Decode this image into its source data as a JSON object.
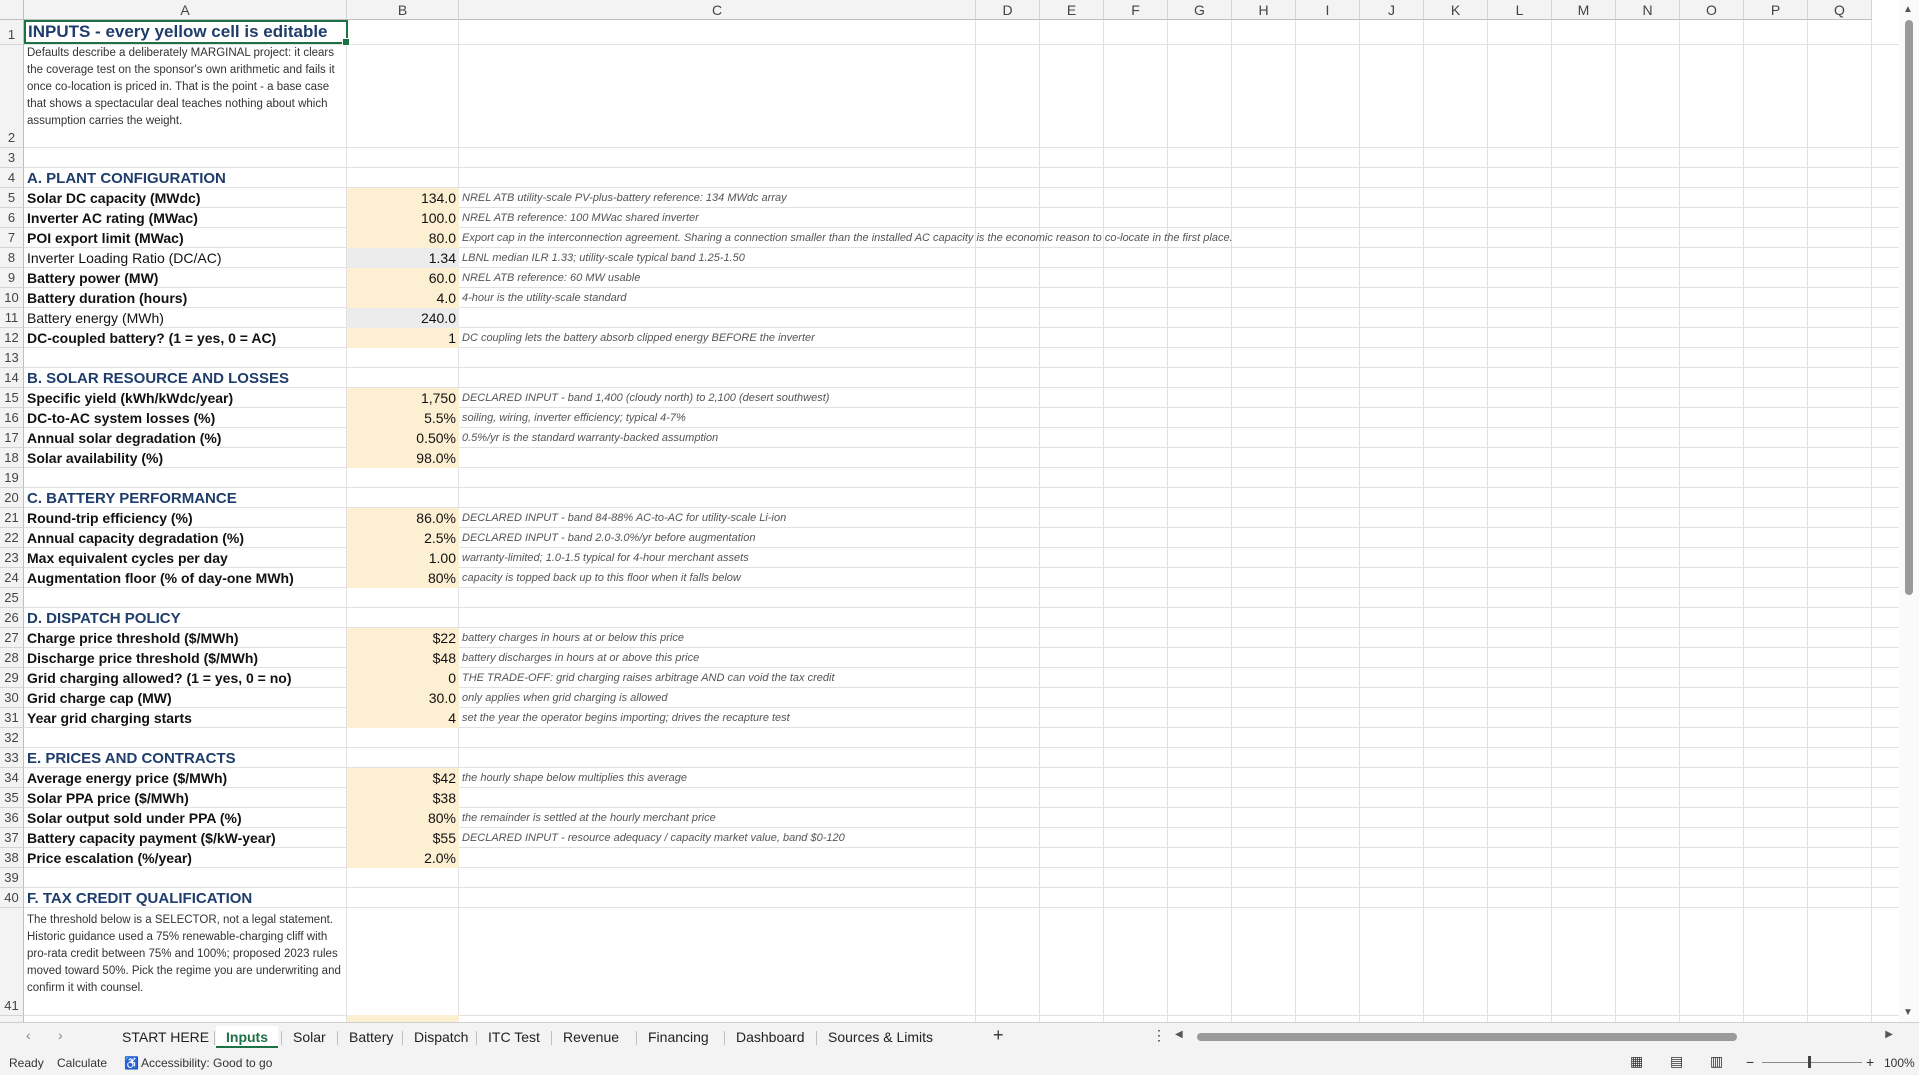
{
  "columns": [
    "A",
    "B",
    "C",
    "D",
    "E",
    "F",
    "G",
    "H",
    "I",
    "J",
    "K",
    "L",
    "M",
    "N",
    "O",
    "P",
    "Q"
  ],
  "title": "INPUTS - every yellow cell is editable",
  "intro_note": "Defaults describe a deliberately MARGINAL project: it clears the coverage test on the sponsor's own arithmetic and fails it once co-location is priced in. That is the point - a base case that shows a spectacular deal teaches nothing about which assumption carries the weight.",
  "rows": [
    {
      "num": "3",
      "a": "",
      "b": "",
      "c": ""
    },
    {
      "num": "4",
      "a": "A. PLANT CONFIGURATION",
      "b": "",
      "c": "",
      "kind": "section"
    },
    {
      "num": "5",
      "a": "Solar DC capacity (MWdc)",
      "b": "134.0",
      "c": "NREL ATB utility-scale PV-plus-battery reference: 134 MWdc array",
      "kind": "input"
    },
    {
      "num": "6",
      "a": "Inverter AC rating (MWac)",
      "b": "100.0",
      "c": "NREL ATB reference: 100 MWac shared inverter",
      "kind": "input"
    },
    {
      "num": "7",
      "a": "POI export limit (MWac)",
      "b": "80.0",
      "c": "Export cap in the interconnection agreement. Sharing a connection smaller than the installed AC capacity is the economic reason to co-locate in the first place.",
      "kind": "input"
    },
    {
      "num": "8",
      "a": "Inverter Loading Ratio (DC/AC)",
      "b": "1.34",
      "c": "LBNL median ILR 1.33; utility-scale typical band 1.25-1.50",
      "kind": "calc"
    },
    {
      "num": "9",
      "a": "Battery power (MW)",
      "b": "60.0",
      "c": "NREL ATB reference: 60 MW usable",
      "kind": "input"
    },
    {
      "num": "10",
      "a": "Battery duration (hours)",
      "b": "4.0",
      "c": "4-hour is the utility-scale standard",
      "kind": "input"
    },
    {
      "num": "11",
      "a": "Battery energy (MWh)",
      "b": "240.0",
      "c": "",
      "kind": "calc"
    },
    {
      "num": "12",
      "a": "DC-coupled battery? (1 = yes, 0 = AC)",
      "b": "1",
      "c": "DC coupling lets the battery absorb clipped energy BEFORE the inverter",
      "kind": "input"
    },
    {
      "num": "13",
      "a": "",
      "b": "",
      "c": ""
    },
    {
      "num": "14",
      "a": "B. SOLAR RESOURCE AND LOSSES",
      "b": "",
      "c": "",
      "kind": "section"
    },
    {
      "num": "15",
      "a": "Specific yield (kWh/kWdc/year)",
      "b": "1,750",
      "c": "DECLARED INPUT - band 1,400 (cloudy north) to 2,100 (desert southwest)",
      "kind": "input"
    },
    {
      "num": "16",
      "a": "DC-to-AC system losses (%)",
      "b": "5.5%",
      "c": "soiling, wiring, inverter efficiency; typical 4-7%",
      "kind": "input"
    },
    {
      "num": "17",
      "a": "Annual solar degradation (%)",
      "b": "0.50%",
      "c": "0.5%/yr is the standard warranty-backed assumption",
      "kind": "input"
    },
    {
      "num": "18",
      "a": "Solar availability (%)",
      "b": "98.0%",
      "c": "",
      "kind": "input"
    },
    {
      "num": "19",
      "a": "",
      "b": "",
      "c": ""
    },
    {
      "num": "20",
      "a": "C. BATTERY PERFORMANCE",
      "b": "",
      "c": "",
      "kind": "section"
    },
    {
      "num": "21",
      "a": "Round-trip efficiency (%)",
      "b": "86.0%",
      "c": "DECLARED INPUT - band 84-88% AC-to-AC for utility-scale Li-ion",
      "kind": "input"
    },
    {
      "num": "22",
      "a": "Annual capacity degradation (%)",
      "b": "2.5%",
      "c": "DECLARED INPUT - band 2.0-3.0%/yr before augmentation",
      "kind": "input"
    },
    {
      "num": "23",
      "a": "Max equivalent cycles per day",
      "b": "1.00",
      "c": "warranty-limited; 1.0-1.5 typical for 4-hour merchant assets",
      "kind": "input"
    },
    {
      "num": "24",
      "a": "Augmentation floor (% of day-one MWh)",
      "b": "80%",
      "c": "capacity is topped back up to this floor when it falls below",
      "kind": "input"
    },
    {
      "num": "25",
      "a": "",
      "b": "",
      "c": ""
    },
    {
      "num": "26",
      "a": "D. DISPATCH POLICY",
      "b": "",
      "c": "",
      "kind": "section"
    },
    {
      "num": "27",
      "a": "Charge price threshold ($/MWh)",
      "b": "$22",
      "c": "battery charges in hours at or below this price",
      "kind": "input"
    },
    {
      "num": "28",
      "a": "Discharge price threshold ($/MWh)",
      "b": "$48",
      "c": "battery discharges in hours at or above this price",
      "kind": "input"
    },
    {
      "num": "29",
      "a": "Grid charging allowed? (1 = yes, 0 = no)",
      "b": "0",
      "c": "THE TRADE-OFF: grid charging raises arbitrage AND can void the tax credit",
      "kind": "input"
    },
    {
      "num": "30",
      "a": "Grid charge cap (MW)",
      "b": "30.0",
      "c": "only applies when grid charging is allowed",
      "kind": "input"
    },
    {
      "num": "31",
      "a": "Year grid charging starts",
      "b": "4",
      "c": "set the year the operator begins importing; drives the recapture test",
      "kind": "input"
    },
    {
      "num": "32",
      "a": "",
      "b": "",
      "c": ""
    },
    {
      "num": "33",
      "a": "E. PRICES AND CONTRACTS",
      "b": "",
      "c": "",
      "kind": "section"
    },
    {
      "num": "34",
      "a": "Average energy price ($/MWh)",
      "b": "$42",
      "c": "the hourly shape below multiplies this average",
      "kind": "input"
    },
    {
      "num": "35",
      "a": "Solar PPA price ($/MWh)",
      "b": "$38",
      "c": "",
      "kind": "input"
    },
    {
      "num": "36",
      "a": "Solar output sold under PPA (%)",
      "b": "80%",
      "c": "the remainder is settled at the hourly merchant price",
      "kind": "input"
    },
    {
      "num": "37",
      "a": "Battery capacity payment ($/kW-year)",
      "b": "$55",
      "c": "DECLARED INPUT - resource adequacy / capacity market value, band $0-120",
      "kind": "input"
    },
    {
      "num": "38",
      "a": "Price escalation (%/year)",
      "b": "2.0%",
      "c": "",
      "kind": "input"
    },
    {
      "num": "39",
      "a": "",
      "b": "",
      "c": ""
    },
    {
      "num": "40",
      "a": "F. TAX CREDIT QUALIFICATION",
      "b": "",
      "c": "",
      "kind": "section"
    }
  ],
  "tax_note": "The threshold below is a SELECTOR, not a legal statement. Historic guidance used a 75% renewable-charging cliff with pro-rata credit between 75% and 100%; proposed 2023 rules moved toward 50%. Pick the regime you are underwriting and confirm it with counsel.",
  "tabs": [
    "START HERE",
    "Inputs",
    "Solar",
    "Battery",
    "Dispatch",
    "ITC Test",
    "Revenue",
    "Financing",
    "Dashboard",
    "Sources & Limits"
  ],
  "active_tab": "Inputs",
  "status": {
    "ready": "Ready",
    "calculate": "Calculate",
    "accessibility": "Accessibility: Good to go",
    "zoom": "100%"
  }
}
